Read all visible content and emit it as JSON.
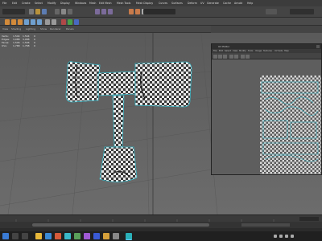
{
  "menubar": {
    "items": [
      "File",
      "Edit",
      "Create",
      "Select",
      "Modify",
      "Display",
      "Windows",
      "Mesh",
      "Edit Mesh",
      "Mesh Tools",
      "Mesh Display",
      "Curves",
      "Surfaces",
      "Deform",
      "UV",
      "Generate",
      "Cache",
      "Arnold",
      "Help"
    ]
  },
  "viewport_menu": {
    "items": [
      "View",
      "Shading",
      "Lighting",
      "Show",
      "Renderer",
      "Panels"
    ]
  },
  "hud": {
    "rows": [
      {
        "label": "Verts:",
        "a": "1,544",
        "b": "1,544",
        "c": "0"
      },
      {
        "label": "Edges:",
        "a": "3,088",
        "b": "3,088",
        "c": "0"
      },
      {
        "label": "Faces:",
        "a": "1,546",
        "b": "1,546",
        "c": "0"
      },
      {
        "label": "UVs:",
        "a": "1,768",
        "b": "1,768",
        "c": "0"
      }
    ]
  },
  "uv_editor": {
    "title": "UV Editor",
    "menu": [
      "File",
      "Edit",
      "Select",
      "View",
      "Modify",
      "Tools",
      "Image",
      "Textures",
      "UV Sets",
      "Help"
    ]
  },
  "colors": {
    "uv_shells": "#39b8c8",
    "selection": "#5ad6e6",
    "menubar_bg": "#3c3c3c"
  }
}
